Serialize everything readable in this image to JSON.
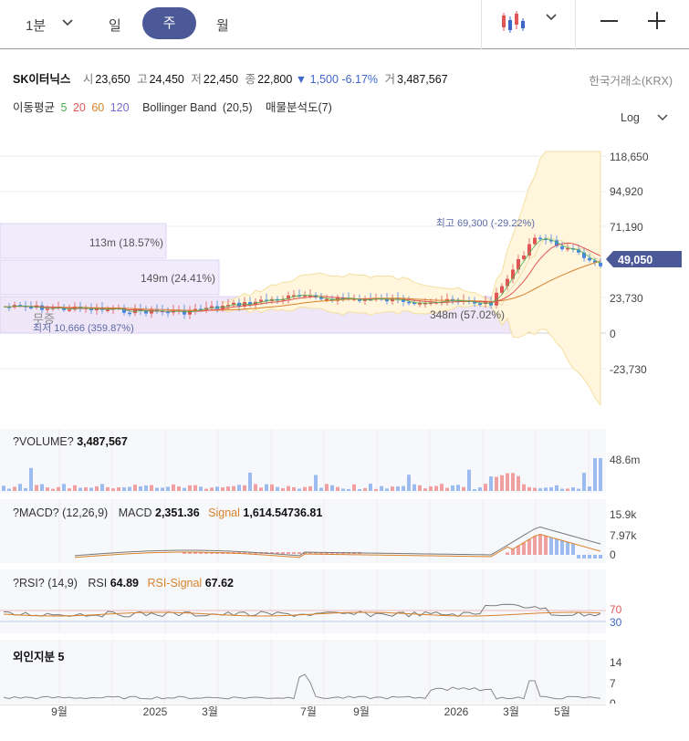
{
  "toolbar": {
    "minute": "1분",
    "day": "일",
    "week": "주",
    "month": "월"
  },
  "stock": {
    "name": "SK이터닉스",
    "open_label": "시",
    "open": "23,650",
    "high_label": "고",
    "high": "24,450",
    "low_label": "저",
    "low": "22,450",
    "close_label": "종",
    "close": "22,800",
    "change": "▼ 1,500",
    "change_pct": "-6.17%",
    "volume_label": "거",
    "volume": "3,487,567",
    "exchange": "한국거래소(KRX)"
  },
  "indicators": {
    "ma_label": "이동평균",
    "ma5": "5",
    "ma20": "20",
    "ma60": "60",
    "ma120": "120",
    "bollinger": "Bollinger Band",
    "bollinger_params": "(20,5)",
    "volume_profile": "매물분석도(7)",
    "log": "Log"
  },
  "main_chart": {
    "y_ticks": [
      "118,650",
      "94,920",
      "71,190",
      "23,730",
      "0",
      "-23,730"
    ],
    "current_price": "49,050",
    "high_marker": "최고 69,300 (-29.22%)",
    "low_marker": "최저 10,666 (359.87%)",
    "profile_labels": [
      "113m (18.57%)",
      "149m (24.41%)",
      "348m (57.02%)"
    ],
    "no_data": "무증"
  },
  "volume_panel": {
    "title": "?VOLUME?",
    "value": "3,487,567",
    "tick": "48.6m"
  },
  "macd_panel": {
    "title": "?MACD? (12,26,9)",
    "macd_label": "MACD",
    "macd_value": "2,351.36",
    "signal_label": "Signal",
    "signal_value": "1,614.54736.81",
    "ticks": [
      "15.9k",
      "7.97k",
      "0"
    ]
  },
  "rsi_panel": {
    "title": "?RSI? (14,9)",
    "rsi_label": "RSI",
    "rsi_value": "64.89",
    "signal_label": "RSI-Signal",
    "signal_value": "67.62",
    "ticks": [
      "70",
      "30"
    ]
  },
  "foreign_panel": {
    "title": "외인지분 5",
    "ticks": [
      "14",
      "7",
      "0"
    ]
  },
  "x_axis": [
    "9월",
    "2025",
    "3월",
    "7월",
    "9월",
    "2026",
    "3월",
    "5월"
  ],
  "colors": {
    "up": "#e05656",
    "down": "#4a86e0",
    "accent": "#4b5998",
    "bollinger_fill": "#fff5dc",
    "profile_fill": "#ece4fb"
  }
}
